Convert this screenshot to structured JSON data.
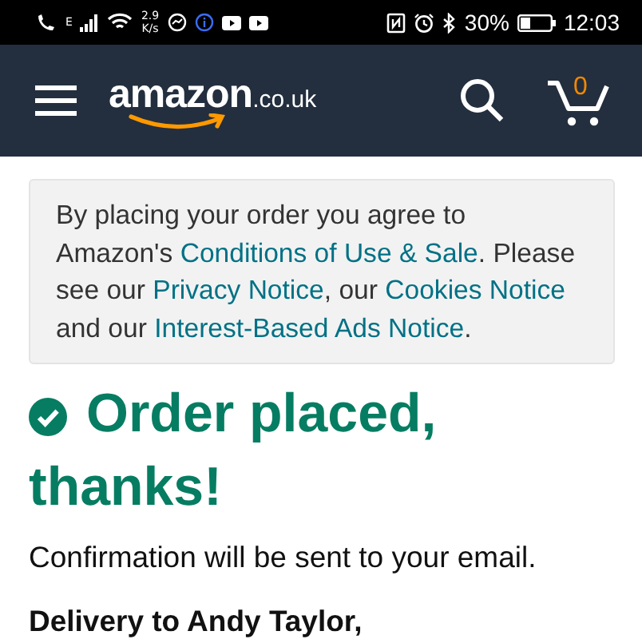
{
  "status_bar": {
    "network_type": "E",
    "speed_value": "2.9",
    "speed_unit": "K/s",
    "battery": "30%",
    "time": "12:03"
  },
  "header": {
    "logo_main": "amazon",
    "logo_suffix": ".co.uk",
    "cart_count": "0"
  },
  "notice": {
    "segments": [
      {
        "text": "By placing your order you agree to Amazon's ",
        "link": false
      },
      {
        "text": "Conditions of Use & Sale",
        "link": true
      },
      {
        "text": ". Please see our ",
        "link": false
      },
      {
        "text": "Privacy Notice",
        "link": true
      },
      {
        "text": ", our ",
        "link": false
      },
      {
        "text": "Cookies Notice",
        "link": true
      },
      {
        "text": " and our ",
        "link": false
      },
      {
        "text": "Interest-Based Ads Notice",
        "link": true
      },
      {
        "text": ".",
        "link": false
      }
    ]
  },
  "confirmation": {
    "heading": "Order placed, thanks!",
    "message": "Confirmation will be sent to your email.",
    "delivery": "Delivery to Andy Taylor,"
  }
}
